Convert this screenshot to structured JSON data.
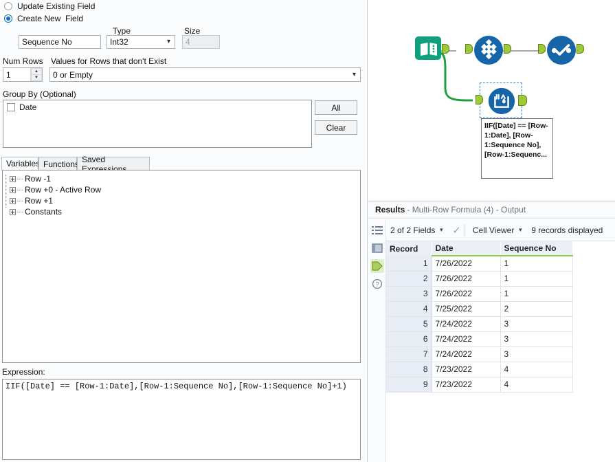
{
  "config": {
    "radio_update": "Update Existing Field",
    "radio_create": "Create New  Field",
    "field_name_value": "Sequence No",
    "type_label": "Type",
    "type_value": "Int32",
    "size_label": "Size",
    "size_value": "4",
    "num_rows_label": "Num Rows",
    "num_rows_value": "1",
    "values_missing_label": "Values for Rows that don't Exist",
    "values_missing_value": "0 or Empty",
    "group_by_label": "Group By (Optional)",
    "group_by_items": [
      {
        "label": "Date",
        "checked": false
      }
    ],
    "all_button": "All",
    "clear_button": "Clear",
    "tabs": [
      {
        "label": "Variables",
        "active": true
      },
      {
        "label": "Functions",
        "active": false
      },
      {
        "label": "Saved Expressions",
        "active": false
      }
    ],
    "tree_nodes": [
      "Row -1",
      "Row +0 - Active Row",
      "Row +1",
      "Constants"
    ],
    "expression_label": "Expression:",
    "expression_value": "IIF([Date] == [Row-1:Date],[Row-1:Sequence No],[Row-1:Sequence No]+1)"
  },
  "canvas": {
    "nodes": [
      {
        "name": "input-data-node",
        "icon": "book-icon"
      },
      {
        "name": "select-node",
        "icon": "diamond-grid-icon"
      },
      {
        "name": "browse-node",
        "icon": "checkmark-dots-icon"
      },
      {
        "name": "multi-row-formula-node",
        "icon": "water-drop-icon",
        "selected": true
      }
    ],
    "annotation_text": "IIF([Date] == [Row-1:Date], [Row-1:Sequence No],[Row-1:Sequenc..."
  },
  "results": {
    "title": "Results",
    "subtitle": "- Multi-Row Formula (4) - Output",
    "fields_selector": "2 of 2 Fields",
    "viewer_selector": "Cell Viewer",
    "records_displayed": "9 records displayed",
    "sidebar_icons": [
      "list-icon",
      "panel-icon",
      "output-anchor-icon",
      "help-icon"
    ],
    "columns": [
      "Record",
      "Date",
      "Sequence No"
    ],
    "rows": [
      {
        "record": "1",
        "date": "7/26/2022",
        "sequence_no": "1"
      },
      {
        "record": "2",
        "date": "7/26/2022",
        "sequence_no": "1"
      },
      {
        "record": "3",
        "date": "7/26/2022",
        "sequence_no": "1"
      },
      {
        "record": "4",
        "date": "7/25/2022",
        "sequence_no": "2"
      },
      {
        "record": "5",
        "date": "7/24/2022",
        "sequence_no": "3"
      },
      {
        "record": "6",
        "date": "7/24/2022",
        "sequence_no": "3"
      },
      {
        "record": "7",
        "date": "7/24/2022",
        "sequence_no": "3"
      },
      {
        "record": "8",
        "date": "7/23/2022",
        "sequence_no": "4"
      },
      {
        "record": "9",
        "date": "7/23/2022",
        "sequence_no": "4"
      }
    ]
  },
  "colors": {
    "accent_blue": "#1665a8",
    "node_teal": "#11a07e",
    "anchor_green": "#9ec93a",
    "wire_green": "#1f9e3f",
    "header_green": "#8ed24a"
  }
}
